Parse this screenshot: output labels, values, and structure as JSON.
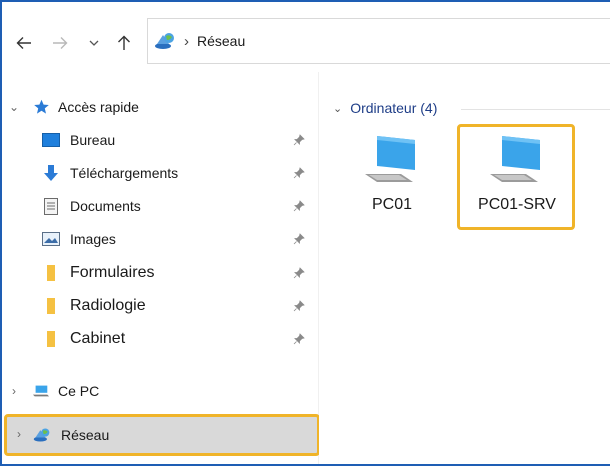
{
  "toolbar": {
    "back_icon": "arrow-left-icon",
    "forward_icon": "arrow-right-icon",
    "recent_icon": "chevron-down-icon",
    "up_icon": "arrow-up-icon"
  },
  "address": {
    "separator": "›",
    "location": "Réseau",
    "icon": "network-icon"
  },
  "navpane": {
    "quick_access": {
      "label": "Accès rapide",
      "icon": "star-icon"
    },
    "items": [
      {
        "label": "Bureau",
        "icon": "desktop-icon",
        "pinned": true
      },
      {
        "label": "Téléchargements",
        "icon": "download-icon",
        "pinned": true
      },
      {
        "label": "Documents",
        "icon": "document-icon",
        "pinned": true
      },
      {
        "label": "Images",
        "icon": "images-icon",
        "pinned": true
      },
      {
        "label": "Formulaires",
        "icon": "folder-icon",
        "pinned": true
      },
      {
        "label": "Radiologie",
        "icon": "folder-icon",
        "pinned": true
      },
      {
        "label": "Cabinet",
        "icon": "folder-icon",
        "pinned": true
      }
    ],
    "this_pc": {
      "label": "Ce PC",
      "icon": "computer-icon"
    },
    "network": {
      "label": "Réseau",
      "icon": "network-icon"
    }
  },
  "content": {
    "group_label": "Ordinateur (4)",
    "computers": [
      {
        "label": "PC01",
        "icon": "computer-icon"
      },
      {
        "label": "PC01-SRV",
        "icon": "computer-icon"
      }
    ]
  },
  "colors": {
    "frame_border": "#1e5eb4",
    "highlight": "#f0b429",
    "selected_bg": "#d9d9d9",
    "group_header": "#1e3d87"
  }
}
